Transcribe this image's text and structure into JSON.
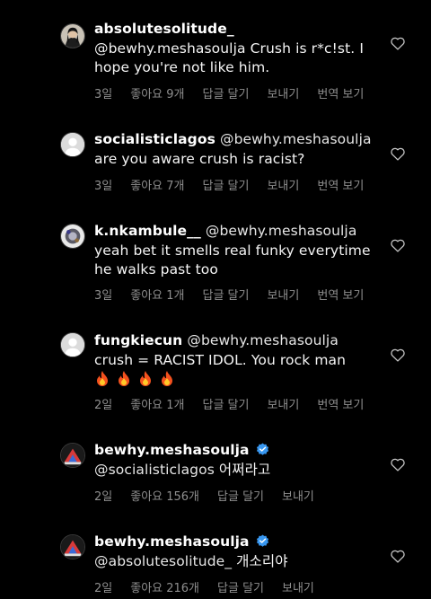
{
  "comments": [
    {
      "username": "absolutesolitude_",
      "text_line1": "@bewhy.meshasoulja Crush is r*c!st. I",
      "text_line2": "hope you're not like him.",
      "age": "3일",
      "likes": "좋아요 9개",
      "reply": "답글 달기",
      "send": "보내기",
      "translate": "번역 보기",
      "avatar": "photo"
    },
    {
      "username": "socialisticlagos",
      "mention": "@bewhy.meshasoulja",
      "text_line2": "are you aware crush is racist?",
      "age": "3일",
      "likes": "좋아요 7개",
      "reply": "답글 달기",
      "send": "보내기",
      "translate": "번역 보기",
      "avatar": "default"
    },
    {
      "username": "k.nkambule__",
      "mention": "@bewhy.meshasoulja",
      "text_line2": "yeah bet it smells real funky everytime",
      "text_line3": "he walks past too",
      "age": "3일",
      "likes": "좋아요 1개",
      "reply": "답글 달기",
      "send": "보내기",
      "translate": "번역 보기",
      "avatar": "photo"
    },
    {
      "username": "fungkiecun",
      "mention": "@bewhy.meshasoulja",
      "text_line2": "crush = RACIST IDOL. You rock man",
      "emoji_count": 4,
      "emoji": "fire",
      "age": "2일",
      "likes": "좋아요 1개",
      "reply": "답글 달기",
      "send": "보내기",
      "translate": "번역 보기",
      "avatar": "default"
    },
    {
      "username": "bewhy.meshasoulja",
      "verified": true,
      "mention": "@socialisticlagos",
      "text": "어쩌라고",
      "age": "2일",
      "likes": "좋아요 156개",
      "reply": "답글 달기",
      "send": "보내기",
      "avatar": "photo"
    },
    {
      "username": "bewhy.meshasoulja",
      "verified": true,
      "mention": "@absolutesolitude_",
      "text": "개소리야",
      "age": "2일",
      "likes": "좋아요 216개",
      "reply": "답글 달기",
      "send": "보내기",
      "avatar": "photo"
    }
  ],
  "colors": {
    "background": "#000000",
    "text": "#f5f5f5",
    "meta": "#8e8e8e",
    "verified": "#3897f0"
  },
  "icons": {
    "like": "heart-outline-icon",
    "verified": "verified-badge-icon",
    "emoji": "fire-emoji"
  }
}
